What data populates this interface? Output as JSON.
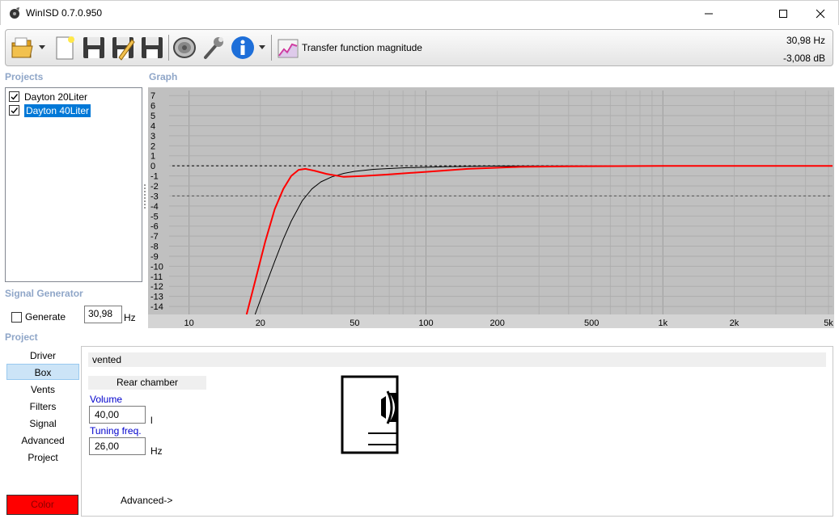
{
  "window": {
    "title": "WinISD 0.7.0.950",
    "buttons": [
      "minimize",
      "maximize",
      "close"
    ]
  },
  "toolbar": {
    "items": [
      "open-folder-icon",
      "new-document-icon",
      "save-icon",
      "save-edit-icon",
      "save-all-icon",
      "speaker-icon",
      "wrench-icon",
      "info-icon",
      "graph-icon"
    ],
    "graph_label": "Transfer function magnitude",
    "readout_freq": "30,98 Hz",
    "readout_level": "-3,008 dB"
  },
  "projects": {
    "header": "Projects",
    "items": [
      {
        "label": "Dayton 20Liter",
        "checked": true,
        "selected": false
      },
      {
        "label": "Dayton 40Liter",
        "checked": true,
        "selected": true
      }
    ]
  },
  "signal_generator": {
    "header": "Signal Generator",
    "generate_label": "Generate",
    "generate_checked": false,
    "value": "30,98",
    "unit": "Hz"
  },
  "graph": {
    "header": "Graph"
  },
  "chart_data": {
    "type": "line",
    "title": "",
    "xlabel": "",
    "ylabel": "",
    "x_scale": "log",
    "xlim": [
      8.5,
      5200
    ],
    "ylim": [
      -14.8,
      7.5
    ],
    "x_tick_labels": [
      "10",
      "20",
      "50",
      "100",
      "200",
      "500",
      "1k",
      "2k",
      "5k"
    ],
    "x_ticks": [
      10,
      20,
      50,
      100,
      200,
      500,
      1000,
      2000,
      5000
    ],
    "y_ticks": [
      7,
      6,
      5,
      4,
      3,
      2,
      1,
      0,
      -1,
      -2,
      -3,
      -4,
      -5,
      -6,
      -7,
      -8,
      -9,
      -10,
      -11,
      -12,
      -13,
      -14
    ],
    "y_tick_labels": [
      "7",
      "6",
      "5",
      "4",
      "3",
      "2",
      "1",
      "0",
      "-1",
      "-2",
      "-3",
      "-4",
      "-5",
      "-6",
      "-7",
      "-8",
      "-9",
      "-10",
      "-11",
      "-12",
      "-13",
      "-14"
    ],
    "reference_lines": [
      0,
      -3
    ],
    "grid": true,
    "background": "#c0c0c0",
    "series": [
      {
        "color": "#ff0000",
        "x": [
          17.5,
          19,
          21,
          23,
          25,
          27,
          29,
          31,
          34,
          38,
          45,
          55,
          70,
          100,
          150,
          250,
          400,
          1000,
          5200
        ],
        "y": [
          -14.8,
          -11.5,
          -7.5,
          -4.3,
          -2.3,
          -1.0,
          -0.4,
          -0.3,
          -0.5,
          -0.8,
          -1.1,
          -1.0,
          -0.85,
          -0.6,
          -0.3,
          -0.1,
          -0.05,
          0.0,
          0.0
        ]
      },
      {
        "color": "#000000",
        "x": [
          19,
          21,
          23,
          25,
          27,
          30,
          33,
          36,
          40,
          45,
          50,
          60,
          80,
          120,
          200,
          400,
          5200
        ],
        "y": [
          -14.8,
          -12.0,
          -9.5,
          -7.3,
          -5.5,
          -3.5,
          -2.3,
          -1.6,
          -1.1,
          -0.75,
          -0.55,
          -0.35,
          -0.2,
          -0.08,
          -0.02,
          0.0,
          0.0
        ]
      }
    ]
  },
  "project_panel": {
    "header": "Project",
    "tabs": [
      "Driver",
      "Box",
      "Vents",
      "Filters",
      "Signal",
      "Advanced",
      "Project"
    ],
    "selected_tab": "Box",
    "color_button": "Color",
    "color_value": "#ff0000"
  },
  "box": {
    "type": "vented",
    "rear_chamber_label": "Rear chamber",
    "volume_label": "Volume",
    "volume_value": "40,00",
    "volume_unit": "l",
    "tuning_label": "Tuning freq.",
    "tuning_value": "26,00",
    "tuning_unit": "Hz",
    "advanced_link": "Advanced->"
  }
}
